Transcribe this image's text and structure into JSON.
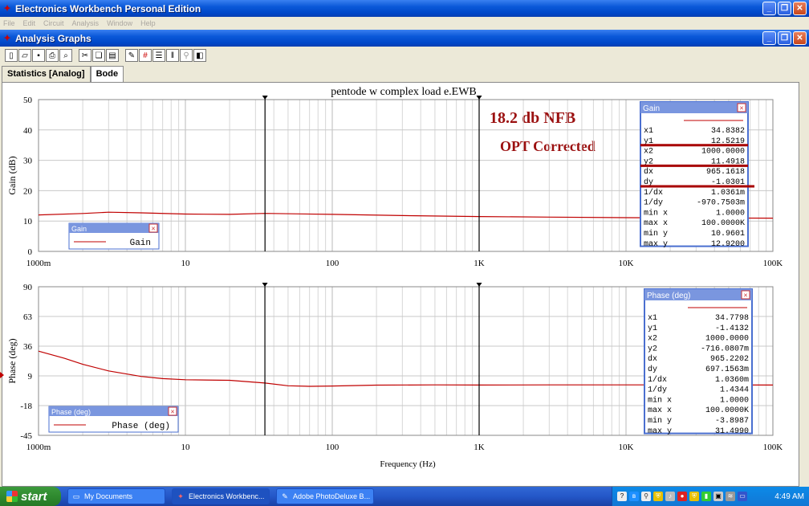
{
  "app": {
    "title": "Electronics Workbench Personal Edition"
  },
  "menu": [
    "File",
    "Edit",
    "Circuit",
    "Analysis",
    "Window",
    "Help"
  ],
  "analysis_window": {
    "title": "Analysis Graphs"
  },
  "toolbar_icons": [
    "new-icon",
    "open-icon",
    "save-icon",
    "print-icon",
    "print-preview-icon",
    "cut-icon",
    "copy-icon",
    "paste-icon",
    "toggle-grid-icon",
    "grid-icon",
    "legend-icon",
    "cursors-icon",
    "zoom-icon",
    "reverse-colors-icon"
  ],
  "tabs": [
    {
      "label": "Statistics [Analog]"
    },
    {
      "label": "Bode",
      "active": true
    }
  ],
  "graph": {
    "title": "pentode w complex load e.EWB",
    "annotation_1": "18.2 db NFB",
    "annotation_2": "OPT Corrected",
    "xlabel": "Frequency (Hz)"
  },
  "chart_data": [
    {
      "type": "line",
      "title": "pentode w complex load e.EWB",
      "xlabel": "",
      "ylabel": "Gain (dB)",
      "xscale": "log",
      "xlim": [
        1,
        100000
      ],
      "ylim": [
        0,
        50
      ],
      "yticks": [
        0,
        10,
        20,
        30,
        40,
        50
      ],
      "xtick_labels": [
        "1000m",
        "10",
        "100",
        "1K",
        "10K",
        "100K"
      ],
      "grid": true,
      "series": [
        {
          "name": "Gain",
          "color": "#c00000",
          "x": [
            1,
            2,
            3,
            5,
            10,
            20,
            34.8,
            100,
            300,
            1000,
            3000,
            10000,
            30000,
            100000
          ],
          "y": [
            12.0,
            12.5,
            12.9,
            12.7,
            12.3,
            12.2,
            12.52,
            12.2,
            11.8,
            11.49,
            11.3,
            11.1,
            11.0,
            10.96
          ]
        }
      ],
      "cursors": [
        34.8382,
        1000
      ],
      "legend": {
        "title": "Gain",
        "entry": "Gain",
        "position": "bottom-left"
      },
      "readout": {
        "title": "Gain",
        "rows": [
          {
            "label": "x1",
            "value": "34.8382"
          },
          {
            "label": "y1",
            "value": "12.5219"
          },
          {
            "label": "x2",
            "value": "1000.0000"
          },
          {
            "label": "y2",
            "value": "11.4918"
          },
          {
            "label": "dx",
            "value": "965.1618"
          },
          {
            "label": "dy",
            "value": "-1.0301"
          },
          {
            "label": "1/dx",
            "value": "1.0361m"
          },
          {
            "label": "1/dy",
            "value": "-970.7503m"
          },
          {
            "label": "min x",
            "value": "1.0000"
          },
          {
            "label": "max x",
            "value": "100.0000K"
          },
          {
            "label": "min y",
            "value": "10.9601"
          },
          {
            "label": "max y",
            "value": "12.9200"
          }
        ]
      }
    },
    {
      "type": "line",
      "ylabel": "Phase (deg)",
      "xlabel": "Frequency (Hz)",
      "xscale": "log",
      "xlim": [
        1,
        100000
      ],
      "ylim": [
        -45,
        90
      ],
      "yticks": [
        -45,
        -18,
        9,
        36,
        63,
        90
      ],
      "xtick_labels": [
        "1000m",
        "10",
        "100",
        "1K",
        "10K",
        "100K"
      ],
      "grid": true,
      "series": [
        {
          "name": "Phase (deg)",
          "color": "#c00000",
          "x": [
            1,
            1.5,
            2,
            3,
            5,
            7,
            10,
            20,
            34.8,
            50,
            70,
            100,
            200,
            500,
            1000,
            3000,
            10000,
            30000,
            100000
          ],
          "y": [
            31.5,
            25,
            19.5,
            13.5,
            8.5,
            6.5,
            5.5,
            5.0,
            2.5,
            0.0,
            -0.5,
            -0.2,
            0.6,
            0.8,
            0.7,
            0.8,
            0.8,
            0.8,
            0.7
          ]
        }
      ],
      "cursors": [
        34.7798,
        1000
      ],
      "legend": {
        "title": "Phase (deg)",
        "entry": "Phase (deg)",
        "position": "bottom-left"
      },
      "readout": {
        "title": "Phase (deg)",
        "rows": [
          {
            "label": "x1",
            "value": "34.7798"
          },
          {
            "label": "y1",
            "value": "-1.4132"
          },
          {
            "label": "x2",
            "value": "1000.0000"
          },
          {
            "label": "y2",
            "value": "-716.0807m"
          },
          {
            "label": "dx",
            "value": "965.2202"
          },
          {
            "label": "dy",
            "value": "697.1563m"
          },
          {
            "label": "1/dx",
            "value": "1.0360m"
          },
          {
            "label": "1/dy",
            "value": "1.4344"
          },
          {
            "label": "min x",
            "value": "1.0000"
          },
          {
            "label": "max x",
            "value": "100.0000K"
          },
          {
            "label": "min y",
            "value": "-3.8987"
          },
          {
            "label": "max y",
            "value": "31.4990"
          }
        ]
      }
    }
  ],
  "taskbar": {
    "start_label": "start",
    "tasks": [
      {
        "label": "My Documents",
        "icon": "folder-icon"
      },
      {
        "label": "Electronics Workbenc...",
        "icon": "ewb-icon",
        "active": true
      },
      {
        "label": "Adobe PhotoDeluxe B...",
        "icon": "photodeluxe-icon"
      }
    ],
    "clock": "4:49 AM"
  }
}
